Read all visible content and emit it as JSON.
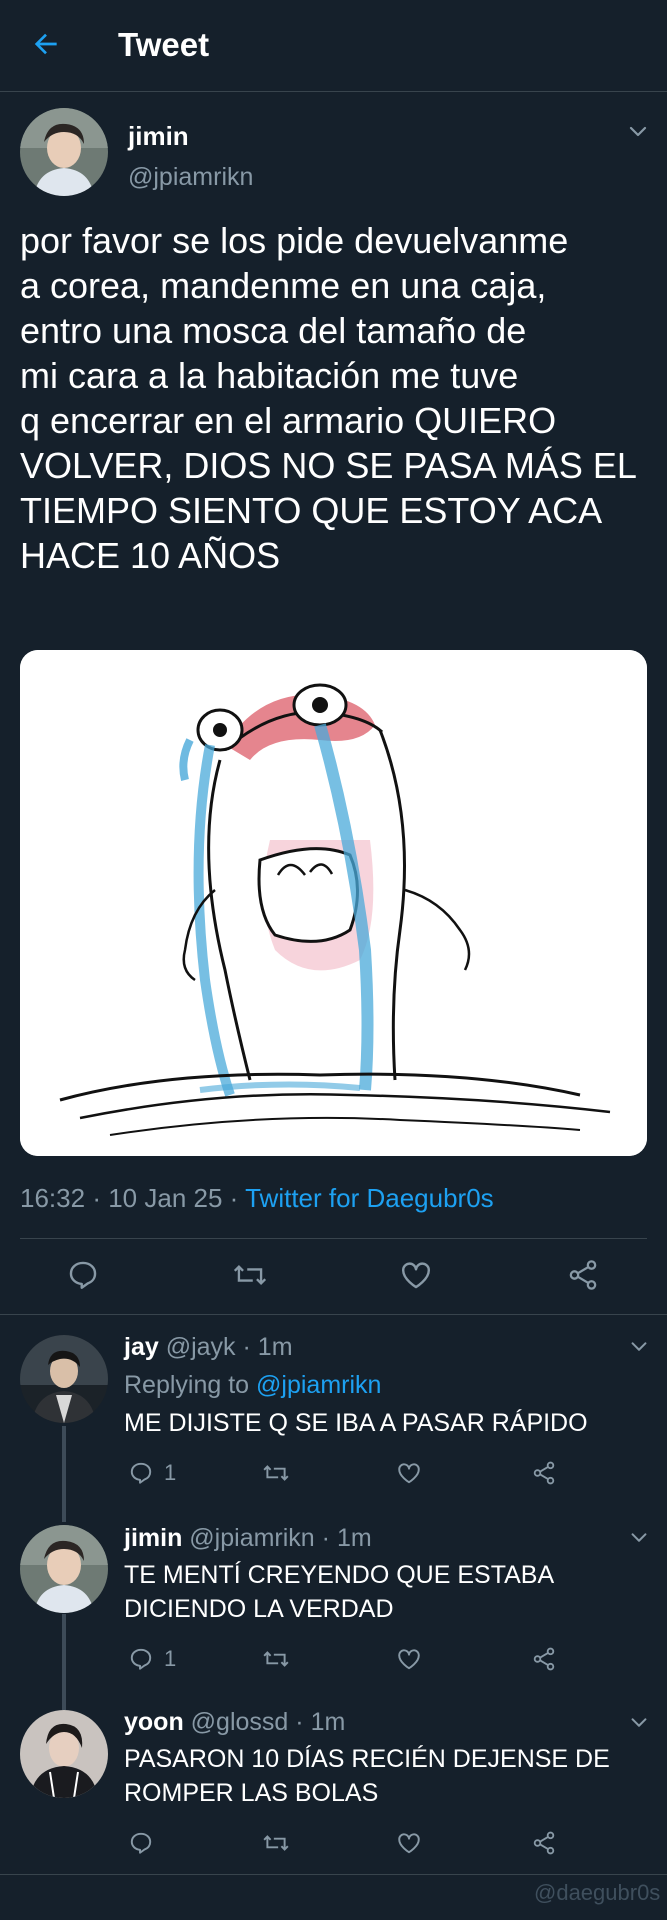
{
  "header": {
    "title": "Tweet",
    "back_icon": "arrow-left-icon"
  },
  "colors": {
    "background": "#15202b",
    "accent": "#1da1f2",
    "secondary_text": "#8899a6",
    "divider": "#38444d"
  },
  "main_tweet": {
    "name": "jimin",
    "handle": "@jpiamrikn",
    "text_lines": [
      "por favor se los pide devuelvanme",
      "a corea, mandenme en una caja,",
      "entro una mosca del tamaño de",
      "mi cara a la habitación me tuve",
      "q encerrar en el armario QUIERO",
      "VOLVER, DIOS NO SE PASA MÁS EL",
      "TIEMPO SIENTO QUE ESTOY ACA",
      "HACE 10 AÑOS"
    ],
    "media_icon": "crying-blob-drawing",
    "time": "16:32",
    "date": "10 Jan 25",
    "separator": "·",
    "source": "Twitter for Daegubr0s"
  },
  "actions": {
    "icons": [
      "reply-icon",
      "retweet-icon",
      "like-icon",
      "share-icon"
    ]
  },
  "replies": [
    {
      "name": "jay",
      "handle": "@jayk",
      "separator": "·",
      "time": "1m",
      "replying_prefix": "Replying to",
      "replying_to": "@jpiamrikn",
      "text_lines": [
        "ME DIJISTE Q SE IBA A PASAR RÁPIDO"
      ],
      "reply_count": "1"
    },
    {
      "name": "jimin",
      "handle": "@jpiamrikn",
      "separator": "·",
      "time": "1m",
      "text_lines": [
        "TE MENTÍ CREYENDO QUE ESTABA",
        "DICIENDO LA VERDAD"
      ],
      "reply_count": "1"
    },
    {
      "name": "yoon",
      "handle": "@glossd",
      "separator": "·",
      "time": "1m",
      "text_lines": [
        "PASARON 10 DÍAS RECIÉN DEJENSE DE",
        "ROMPER LAS BOLAS"
      ],
      "reply_count": ""
    }
  ],
  "watermark": "@daegubr0s"
}
